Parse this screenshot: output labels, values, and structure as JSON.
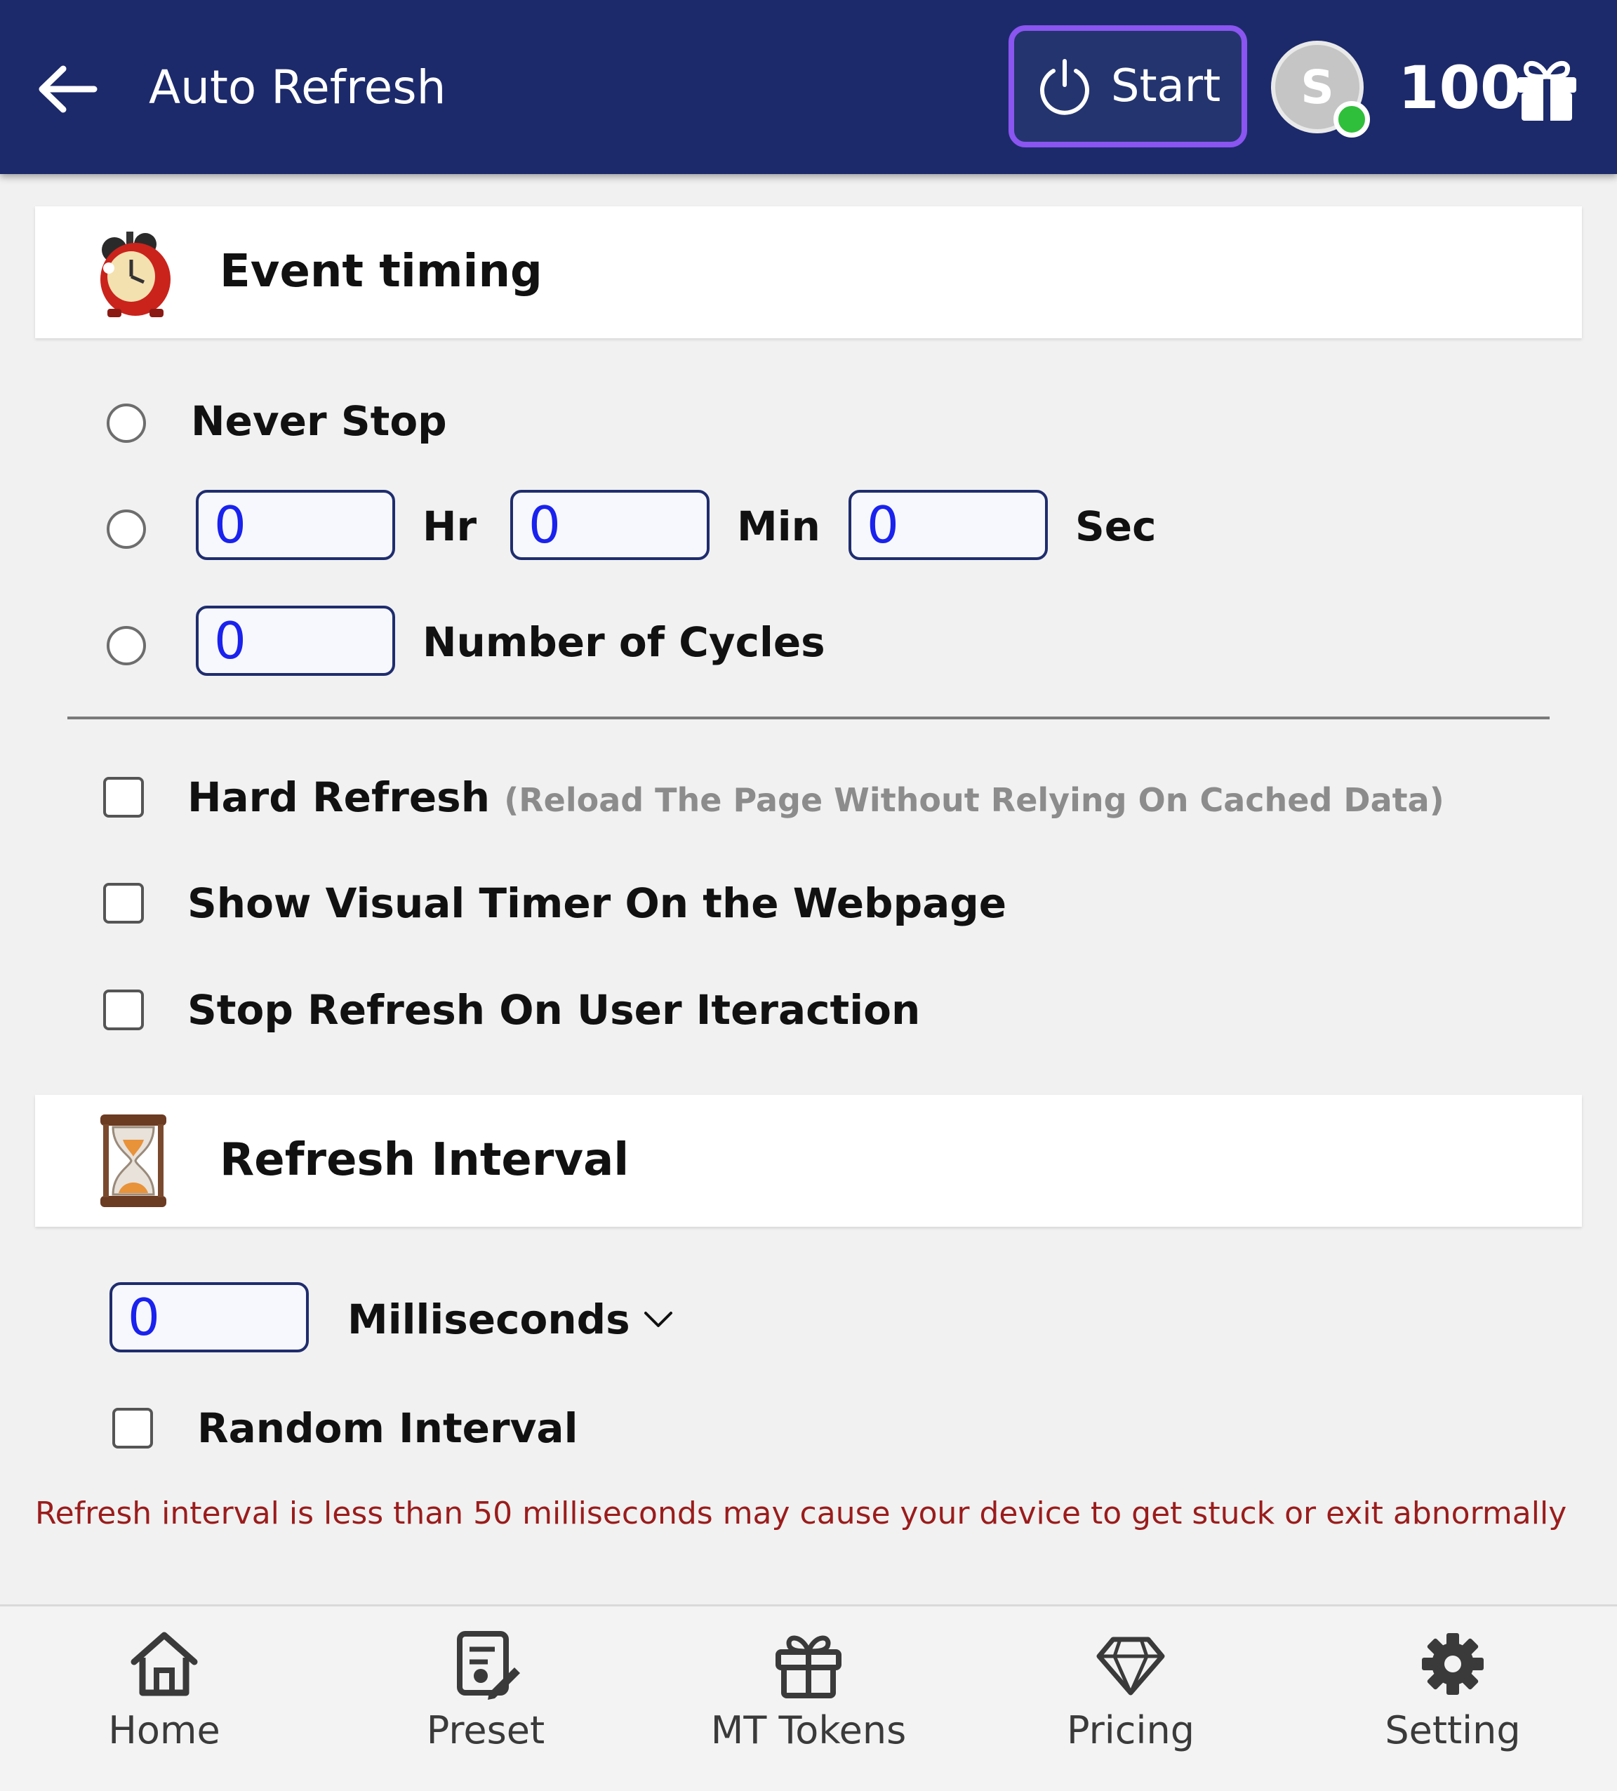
{
  "header": {
    "back_icon": "arrow-left-icon",
    "title": "Auto Refresh",
    "start_label": "Start",
    "start_icon": "power-icon",
    "avatar_letter": "S",
    "token_count": "100",
    "gift_icon": "gift-icon",
    "colors": {
      "bar": "#1c2a6b",
      "start_border": "#8a55f0",
      "online": "#2fbf3a"
    }
  },
  "event_timing": {
    "title": "Event timing",
    "icon": "alarm-clock-icon",
    "never_stop_label": "Never Stop",
    "hours_value": "0",
    "hours_label": "Hr",
    "minutes_value": "0",
    "minutes_label": "Min",
    "seconds_value": "0",
    "seconds_label": "Sec",
    "cycles_value": "0",
    "cycles_label": "Number of Cycles"
  },
  "options": {
    "hard_refresh_label": "Hard Refresh",
    "hard_refresh_hint": "(Reload The Page Without Relying On Cached Data)",
    "visual_timer_label": "Show Visual Timer On the Webpage",
    "stop_on_interaction_label": "Stop Refresh On User Iteraction"
  },
  "refresh_interval": {
    "title": "Refresh Interval",
    "icon": "hourglass-icon",
    "value": "0",
    "unit": "Milliseconds",
    "random_label": "Random Interval",
    "warning": "Refresh interval is less than 50 milliseconds may cause your device to get stuck or exit abnormally"
  },
  "nav": {
    "items": [
      {
        "label": "Home",
        "icon": "home-icon"
      },
      {
        "label": "Preset",
        "icon": "preset-icon"
      },
      {
        "label": "MT Tokens",
        "icon": "gift-icon"
      },
      {
        "label": "Pricing",
        "icon": "diamond-icon"
      },
      {
        "label": "Setting",
        "icon": "gear-icon"
      }
    ]
  }
}
